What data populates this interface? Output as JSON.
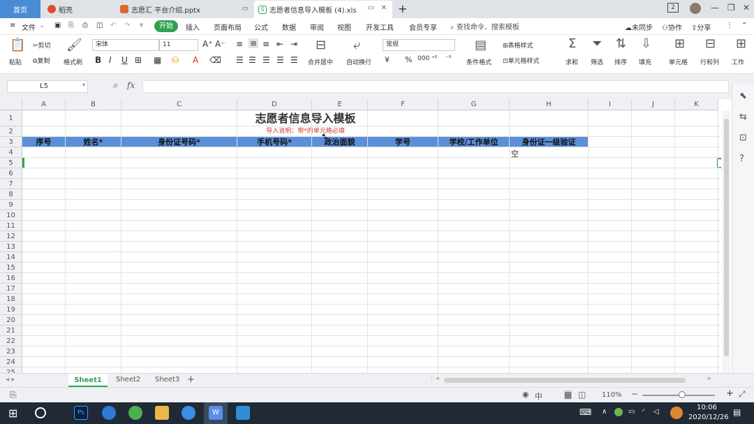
{
  "tabs": {
    "home": "首页",
    "docer": "稻壳",
    "pptx": "志愿汇 平台介绍.pptx",
    "xls": "志愿者信息导入模板 (4).xls",
    "new": "+"
  },
  "window": {
    "badge": "2",
    "min": "—",
    "restore": "❐",
    "close": "✕"
  },
  "menu": {
    "file": "文件",
    "start": "开始",
    "items": [
      "插入",
      "页面布局",
      "公式",
      "数据",
      "审阅",
      "视图",
      "开发工具",
      "会员专享"
    ],
    "search": "查找命令、搜索模板",
    "sync": "未同步",
    "collab": "协作",
    "share": "分享"
  },
  "ribbon": {
    "paste": "粘贴",
    "cut": "剪切",
    "copy": "复制",
    "format_painter": "格式刷",
    "font": "宋体",
    "size": "11",
    "merge": "合并居中",
    "wrap": "自动换行",
    "numfmt": "常规",
    "cond_fmt": "条件格式",
    "table_style": "表格样式",
    "cell_style": "单元格样式",
    "sum": "求和",
    "filter": "筛选",
    "sort": "排序",
    "fill": "填充",
    "cell": "单元格",
    "rowcol": "行和列",
    "worksheet": "工作"
  },
  "formula_bar": {
    "cell_ref": "L5",
    "fx": "fx",
    "value": ""
  },
  "sheet": {
    "columns": [
      "A",
      "B",
      "C",
      "D",
      "E",
      "F",
      "G",
      "H",
      "I",
      "J",
      "K"
    ],
    "rows": [
      "1",
      "2",
      "3",
      "4",
      "5",
      "6",
      "7",
      "8",
      "9",
      "10",
      "11",
      "12",
      "13",
      "14",
      "15",
      "16",
      "17",
      "18",
      "19",
      "20",
      "21",
      "22",
      "23",
      "24",
      "25"
    ],
    "title": "志愿者信息导入模板",
    "subtitle": "导入说明：带*的单元格必填",
    "headers": [
      "序号",
      "姓名*",
      "身份证号码*",
      "手机号码*",
      "政治面貌",
      "学号",
      "学校/工作单位",
      "身份证一级验证"
    ],
    "h4_value": "空"
  },
  "sheet_tabs": [
    "Sheet1",
    "Sheet2",
    "Sheet3",
    "+"
  ],
  "status": {
    "zoom": "110%",
    "ime": "中"
  },
  "taskbar": {
    "time": "10:06",
    "date": "2020/12/26",
    "ps": "Ps"
  },
  "colors": {
    "header_fill": "#5b8fd9",
    "title_red": "#d23a3a",
    "accent_green": "#2fa24f",
    "tab_blue": "#4a8bd6"
  }
}
